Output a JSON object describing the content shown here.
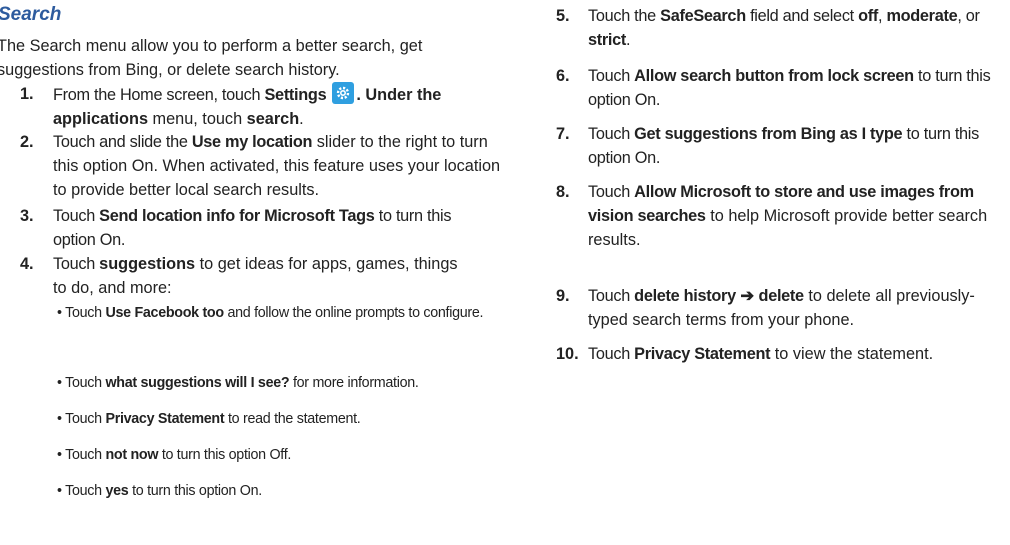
{
  "heading": "Search",
  "intro": "The Search menu allow you to perform a better search, get suggestions from Bing, or delete search history.",
  "left_steps": [
    {
      "num": "1.",
      "t1": "From the Home screen, touch ",
      "b1": "Settings",
      "t2": ". Under the ",
      "b2": "applications",
      "t3": " menu, touch ",
      "b3": "search",
      "t4": "."
    },
    {
      "num": "2.",
      "t1": "Touch and slide the ",
      "b1": "Use my location",
      "t2": " slider to the right to turn this option On. When activated, this feature uses your location to provide better local search results."
    },
    {
      "num": "3.",
      "t1": "Touch ",
      "b1": "Send location info for Microsoft Tags",
      "t2": " to turn this option On."
    },
    {
      "num": "4.",
      "t1": "Touch ",
      "b1": "suggestions",
      "t2": " to get ideas for apps, games, things to do, and more:"
    }
  ],
  "bullets": [
    {
      "t1": "• Touch ",
      "b1": "Use Facebook too",
      "t2": " and follow the online prompts to configure."
    },
    {
      "t1": "• Touch ",
      "b1": "what suggestions will I see?",
      "t2": " for more information."
    },
    {
      "t1": "• Touch ",
      "b1": "Privacy Statement",
      "t2": " to read the statement."
    },
    {
      "t1": "• Touch ",
      "b1": "not now",
      "t2": " to turn this option Off."
    },
    {
      "t1": "• Touch ",
      "b1": "yes",
      "t2": " to turn this option On."
    }
  ],
  "right_steps": [
    {
      "num": "5.",
      "t1": "Touch the ",
      "b1": "SafeSearch",
      "t2": " field and select ",
      "b2": "off",
      "t3": ", ",
      "b3": "moderate",
      "t4": ", or ",
      "b4": "strict",
      "t5": "."
    },
    {
      "num": "6.",
      "t1": "Touch ",
      "b1": "Allow search button from lock screen",
      "t2": " to turn this option On."
    },
    {
      "num": "7.",
      "t1": "Touch ",
      "b1": "Get suggestions from Bing as I type",
      "t2": " to turn this option On."
    },
    {
      "num": "8.",
      "t1": "Touch ",
      "b1": "Allow Microsoft to store and use images from vision searches",
      "t2": " to help Microsoft provide better search results."
    },
    {
      "num": "9.",
      "t1": "Touch ",
      "b1": "delete history",
      "arrow": " ➔ ",
      "b2": "delete",
      "t2": " to delete all previously-typed search terms from your phone."
    },
    {
      "num": "10.",
      "t1": "Touch ",
      "b1": "Privacy Statement",
      "t2": " to view the statement."
    }
  ],
  "icons": {
    "settings": "gear-icon",
    "settings_color": "#2f9fe0"
  }
}
